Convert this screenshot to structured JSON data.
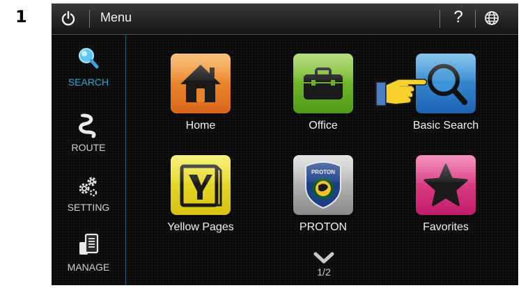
{
  "step_number": "1",
  "topbar": {
    "title": "Menu",
    "help": "?"
  },
  "sidebar": {
    "items": [
      {
        "label": "SEARCH",
        "icon": "search-icon",
        "active": true
      },
      {
        "label": "ROUTE",
        "icon": "route-icon",
        "active": false
      },
      {
        "label": "SETTING",
        "icon": "gears-icon",
        "active": false
      },
      {
        "label": "MANAGE",
        "icon": "manage-icon",
        "active": false
      }
    ]
  },
  "tiles": [
    {
      "label": "Home",
      "icon": "house-icon",
      "color": "#e9832a"
    },
    {
      "label": "Office",
      "icon": "briefcase-icon",
      "color": "#6bb22a"
    },
    {
      "label": "Basic Search",
      "icon": "magnifier-icon",
      "color": "#2f86d0"
    },
    {
      "label": "Yellow Pages",
      "icon": "yellow-pages-icon",
      "color": "#e6da22"
    },
    {
      "label": "PROTON",
      "icon": "proton-logo-icon",
      "color": "#b0b0b0"
    },
    {
      "label": "Favorites",
      "icon": "star-icon",
      "color": "#dc3a83"
    }
  ],
  "pager": {
    "label": "1/2",
    "icon": "chevron-down-icon"
  },
  "accent_color": "#29a9df"
}
